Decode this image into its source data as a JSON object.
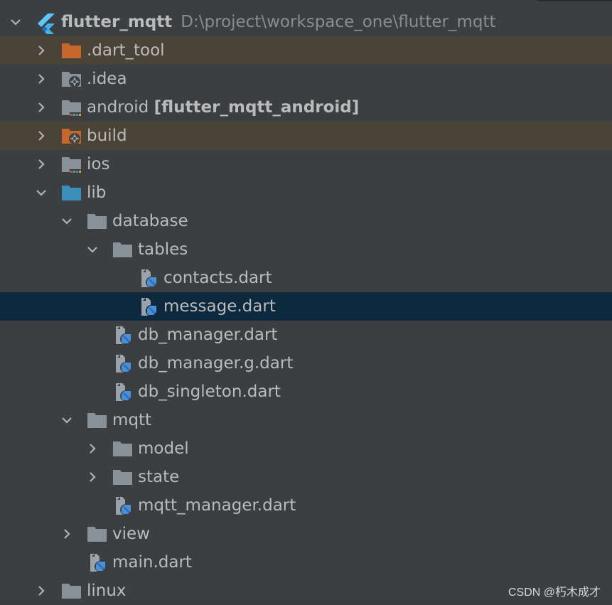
{
  "project": {
    "name": "flutter_mqtt",
    "path": "D:\\project\\workspace_one\\flutter_mqtt"
  },
  "rows": [
    {
      "label": ".dart_tool",
      "arrow": "right",
      "icon": "folder-orange",
      "excluded": true
    },
    {
      "label": ".idea",
      "arrow": "right",
      "icon": "folder-config"
    },
    {
      "label": "android",
      "bold_suffix": "[flutter_mqtt_android]",
      "arrow": "right",
      "icon": "folder-module"
    },
    {
      "label": "build",
      "arrow": "right",
      "icon": "folder-orange-config",
      "excluded": true
    },
    {
      "label": "ios",
      "arrow": "right",
      "icon": "folder-module"
    },
    {
      "label": "lib",
      "arrow": "down",
      "icon": "folder-blue"
    },
    {
      "label": "database",
      "arrow": "down",
      "icon": "folder-gray"
    },
    {
      "label": "tables",
      "arrow": "down",
      "icon": "folder-gray"
    },
    {
      "label": "contacts.dart",
      "icon": "dart-file"
    },
    {
      "label": "message.dart",
      "icon": "dart-file",
      "selected": true
    },
    {
      "label": "db_manager.dart",
      "icon": "dart-file"
    },
    {
      "label": "db_manager.g.dart",
      "icon": "dart-file"
    },
    {
      "label": "db_singleton.dart",
      "icon": "dart-file"
    },
    {
      "label": "mqtt",
      "arrow": "down",
      "icon": "folder-gray"
    },
    {
      "label": "model",
      "arrow": "right",
      "icon": "folder-gray"
    },
    {
      "label": "state",
      "arrow": "right",
      "icon": "folder-gray"
    },
    {
      "label": "mqtt_manager.dart",
      "icon": "dart-file"
    },
    {
      "label": "view",
      "arrow": "right",
      "icon": "folder-gray"
    },
    {
      "label": "main.dart",
      "icon": "dart-file"
    },
    {
      "label": "linux",
      "arrow": "right",
      "icon": "folder-gray"
    }
  ],
  "watermark": "CSDN @朽木成才",
  "colors": {
    "background": "#3c3f41",
    "selected_row": "#0d293e",
    "excluded_row": "#4a4337",
    "text": "#bbbbbb",
    "path_text": "#8c8c8c"
  }
}
